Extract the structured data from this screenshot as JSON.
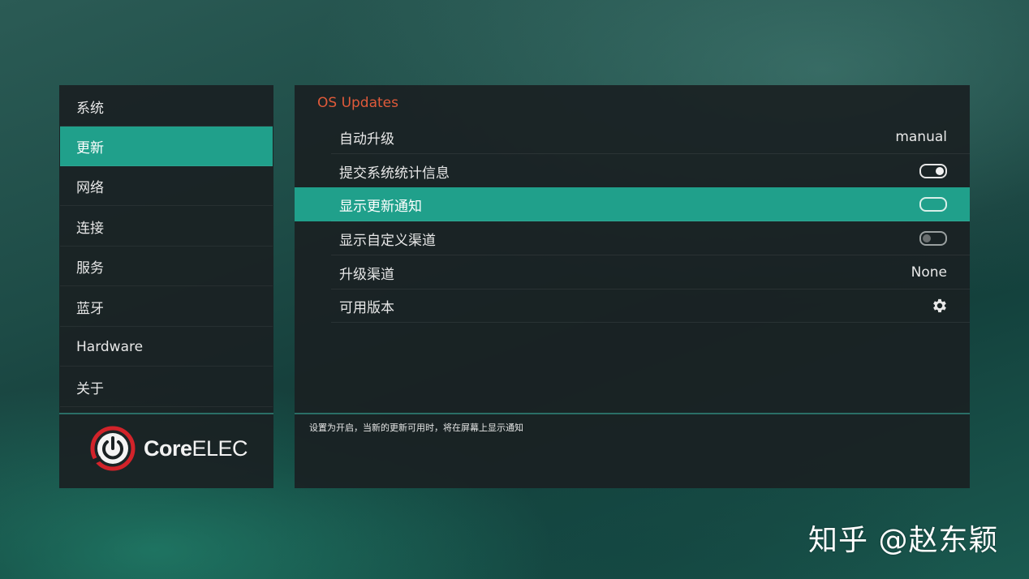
{
  "sidebar": {
    "items": [
      {
        "label": "系统"
      },
      {
        "label": "更新"
      },
      {
        "label": "网络"
      },
      {
        "label": "连接"
      },
      {
        "label": "服务"
      },
      {
        "label": "蓝牙"
      },
      {
        "label": "Hardware"
      },
      {
        "label": "关于"
      }
    ],
    "active_item": "更新",
    "logo": {
      "prefix": "Core",
      "suffix": "ELEC"
    }
  },
  "main": {
    "section_title": "OS Updates",
    "rows": [
      {
        "label": "自动升级",
        "value": "manual"
      },
      {
        "label": "提交系统统计信息",
        "value": "",
        "toggle": "on"
      },
      {
        "label": "显示更新通知",
        "value": "",
        "toggle": "focused"
      },
      {
        "label": "显示自定义渠道",
        "value": "",
        "toggle": "off"
      },
      {
        "label": "升级渠道",
        "value": "None"
      },
      {
        "label": "可用版本",
        "value": "",
        "icon": "gear-icon"
      }
    ],
    "hint": "设置为开启，当新的更新可用时，将在屏幕上显示通知"
  },
  "watermark": "知乎 @赵东颖",
  "colors": {
    "accent": "#20a08b",
    "title": "#e05a3a",
    "logo_red": "#d2232a",
    "panel": "#1a2123"
  }
}
